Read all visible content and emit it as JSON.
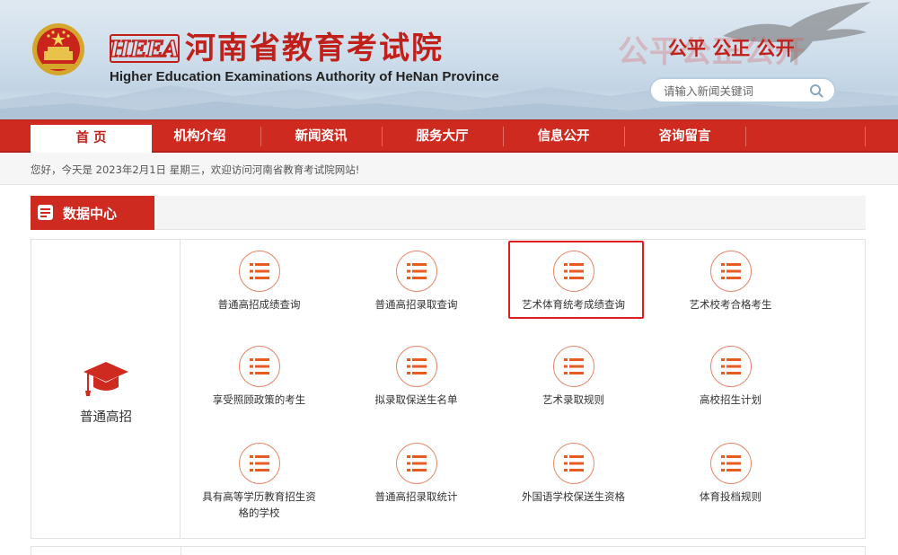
{
  "header": {
    "title": "河南省教育考试院",
    "subtitle": "Higher Education Examinations Authority of HeNan Province",
    "logo_text": "HEEA",
    "slogan_faded": "公平公正公开",
    "slogan": "公平 公正 公开",
    "search_placeholder": "请输入新闻关键词"
  },
  "nav": {
    "items": [
      {
        "label": "首 页",
        "active": true
      },
      {
        "label": "机构介绍",
        "active": false
      },
      {
        "label": "新闻资讯",
        "active": false
      },
      {
        "label": "服务大厅",
        "active": false
      },
      {
        "label": "信息公开",
        "active": false
      },
      {
        "label": "咨询留言",
        "active": false
      }
    ]
  },
  "info_bar": {
    "welcome": "您好，今天是 2023年2月1日 星期三，欢迎访问河南省教育考试院网站!"
  },
  "section": {
    "title": "数据中心"
  },
  "panel": {
    "category_label": "普通高招",
    "items": [
      {
        "label": "普通高招成绩查询"
      },
      {
        "label": "普通高招录取查询"
      },
      {
        "label": "艺术体育统考成绩查询"
      },
      {
        "label": "艺术校考合格考生"
      },
      {
        "label": "享受照顾政策的考生"
      },
      {
        "label": "拟录取保送生名单"
      },
      {
        "label": "艺术录取规则"
      },
      {
        "label": "高校招生计划"
      },
      {
        "label": "具有高等学历教育招生资格的学校"
      },
      {
        "label": "普通高招录取统计"
      },
      {
        "label": "外国语学校保送生资格"
      },
      {
        "label": "体育投档规则"
      }
    ]
  },
  "colors": {
    "brand_red": "#cf2a20",
    "icon_orange": "#e85a22",
    "highlight_red": "#dd1f1f"
  },
  "icons": {
    "emblem": "national-emblem-icon",
    "search": "search-icon",
    "section": "document-icon",
    "category": "graduation-cap-icon",
    "item": "list-icon"
  }
}
